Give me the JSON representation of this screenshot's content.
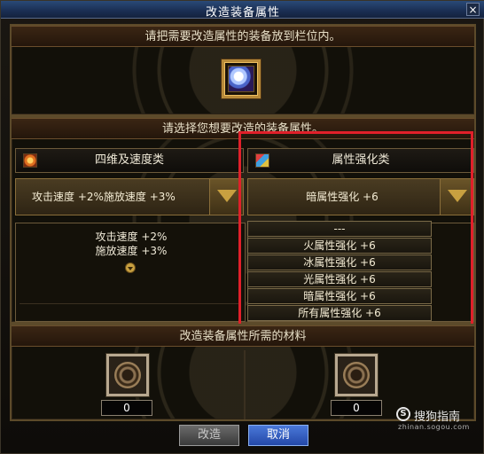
{
  "window": {
    "title": "改造装备属性",
    "close_glyph": "×"
  },
  "top_section": {
    "header": "请把需要改造属性的装备放到栏位内。",
    "equipment_slot_item": "equipment-item-icon"
  },
  "attribute_section": {
    "header": "请选择您想要改造的装备属性。",
    "left": {
      "category_label": "四维及速度类",
      "selected_value": "攻击速度 +2%施放速度 +3%",
      "desc_line1": "攻击速度 +2%",
      "desc_line2": "施放速度 +3%"
    },
    "right": {
      "category_label": "属性强化类",
      "selected_value": "暗属性强化 +6",
      "dropdown_options": [
        "---",
        "火属性强化 +6",
        "冰属性强化 +6",
        "光属性强化 +6",
        "暗属性强化 +6",
        "所有属性强化 +6"
      ]
    }
  },
  "materials_section": {
    "header": "改造装备属性所需的材料",
    "left_count": "0",
    "right_count": "0"
  },
  "buttons": {
    "modify": "改造",
    "cancel": "取消"
  },
  "watermark": {
    "logo_glyph": "S",
    "name": "搜狗指南",
    "url": "zhinan.sogou.com"
  },
  "colors": {
    "highlight": "#e0202a",
    "cancel_button": "#2448a8",
    "frame_gold": "#b88a3a"
  }
}
